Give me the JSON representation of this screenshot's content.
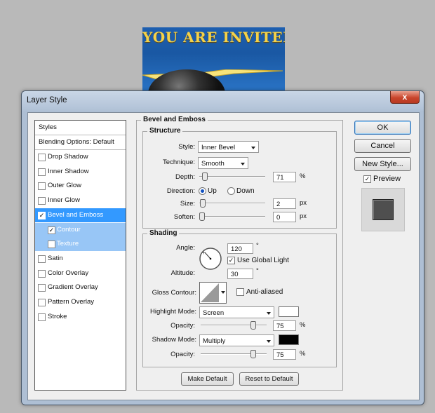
{
  "artwork": {
    "title": "YOU ARE INVITED"
  },
  "window": {
    "title": "Layer Style",
    "close_label": "x"
  },
  "style_list": {
    "header": "Styles",
    "blending": "Blending Options: Default",
    "items": [
      {
        "label": "Drop Shadow",
        "checked": false
      },
      {
        "label": "Inner Shadow",
        "checked": false
      },
      {
        "label": "Outer Glow",
        "checked": false
      },
      {
        "label": "Inner Glow",
        "checked": false
      },
      {
        "label": "Bevel and Emboss",
        "checked": true,
        "active": true
      },
      {
        "label": "Contour",
        "checked": true,
        "sub": true
      },
      {
        "label": "Texture",
        "checked": false,
        "sub": true
      },
      {
        "label": "Satin",
        "checked": false
      },
      {
        "label": "Color Overlay",
        "checked": false
      },
      {
        "label": "Gradient Overlay",
        "checked": false
      },
      {
        "label": "Pattern Overlay",
        "checked": false
      },
      {
        "label": "Stroke",
        "checked": false
      }
    ]
  },
  "bevel": {
    "section_title": "Bevel and Emboss",
    "structure": {
      "title": "Structure",
      "style_label": "Style:",
      "style_value": "Inner Bevel",
      "technique_label": "Technique:",
      "technique_value": "Smooth",
      "depth_label": "Depth:",
      "depth_value": "71",
      "depth_unit": "%",
      "depth_level": 0.04,
      "direction_label": "Direction:",
      "direction_up": "Up",
      "direction_down": "Down",
      "direction_selected": "Up",
      "size_label": "Size:",
      "size_value": "2",
      "size_unit": "px",
      "size_level": 0.01,
      "soften_label": "Soften:",
      "soften_value": "0",
      "soften_unit": "px",
      "soften_level": 0.0
    },
    "shading": {
      "title": "Shading",
      "angle_label": "Angle:",
      "angle_value": "120",
      "angle_unit": "°",
      "global_light_label": "Use Global Light",
      "global_light_checked": true,
      "altitude_label": "Altitude:",
      "altitude_value": "30",
      "altitude_unit": "°",
      "gloss_label": "Gloss Contour:",
      "anti_aliased_label": "Anti-aliased",
      "anti_aliased_checked": false,
      "highlight_label": "Highlight Mode:",
      "highlight_value": "Screen",
      "highlight_color": "#ffffff",
      "hl_opacity_label": "Opacity:",
      "hl_opacity_value": "75",
      "hl_opacity_unit": "%",
      "hl_opacity_level": 0.75,
      "shadow_label": "Shadow Mode:",
      "shadow_value": "Multiply",
      "shadow_color": "#000000",
      "sh_opacity_label": "Opacity:",
      "sh_opacity_value": "75",
      "sh_opacity_unit": "%",
      "sh_opacity_level": 0.75
    },
    "make_default": "Make Default",
    "reset_default": "Reset to Default"
  },
  "actions": {
    "ok": "OK",
    "cancel": "Cancel",
    "new_style": "New Style...",
    "preview_label": "Preview",
    "preview_checked": true
  }
}
